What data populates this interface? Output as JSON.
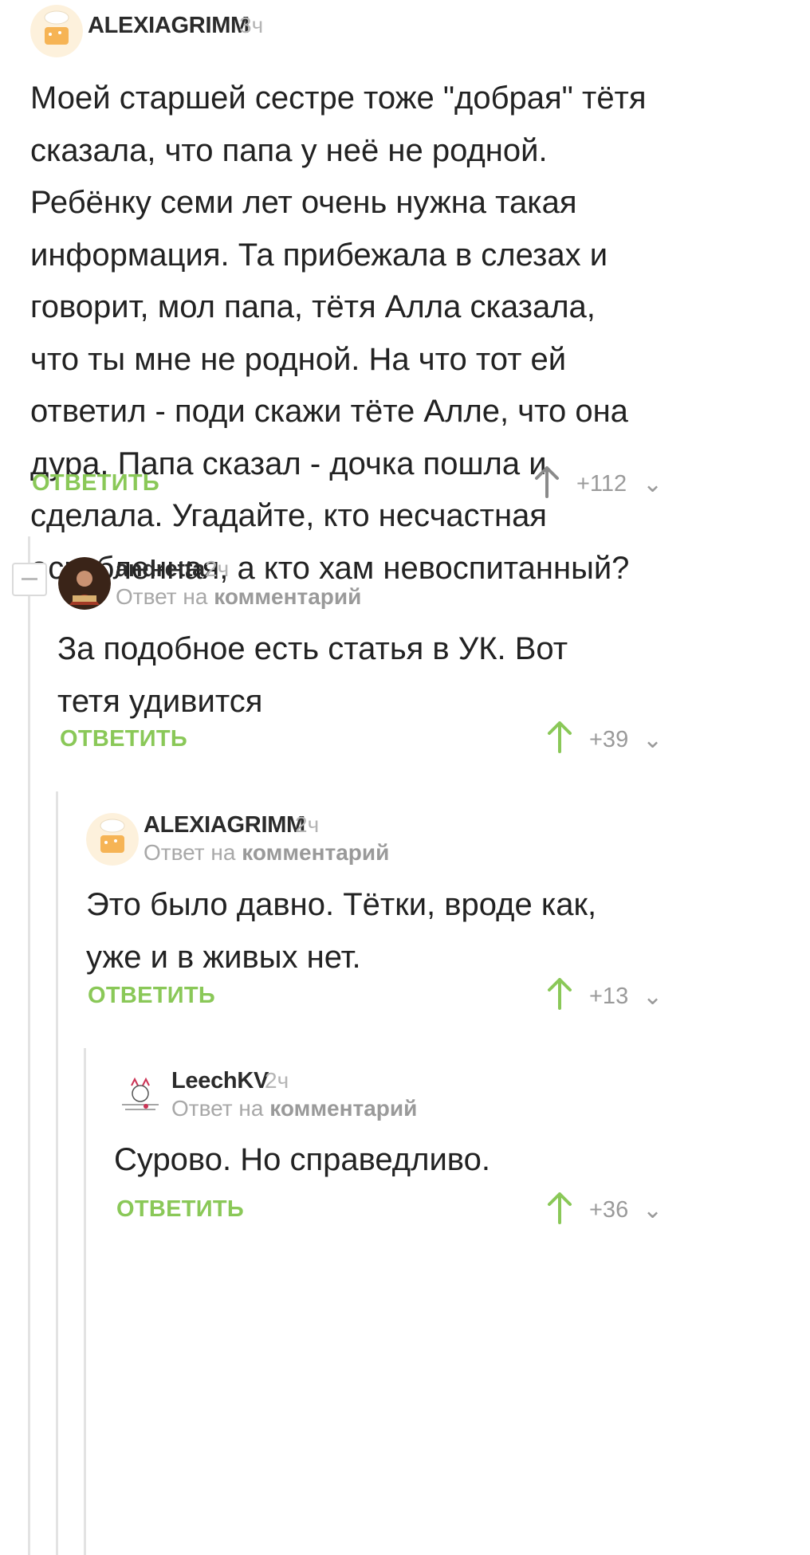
{
  "comments": [
    {
      "username": "ALEXIAGRIMM",
      "time": "3ч",
      "text": "Моей старшей сестре тоже \"добрая\" тётя сказала, что папа у неё не родной. Ребёнку семи лет очень нужна такая информация. Та прибежала в слезах и говорит, мол папа, тётя Алла сказала, что ты мне не родной. На что тот ей ответил - поди скажи тёте Алле, что она дура. Папа сказал - дочка пошла и сделала. Угадайте, кто несчастная оскобленная, а кто хам невоспитанный?",
      "reply_label": "ОТВЕТИТЬ",
      "rating": "+112",
      "arrow_color": "#8a8a8a"
    },
    {
      "username": "andretta",
      "time": "2ч",
      "reply_to_prefix": "Ответ на",
      "reply_to_link": "комментарий",
      "text": "За подобное есть статья в УК. Вот тетя удивится",
      "reply_label": "ОТВЕТИТЬ",
      "rating": "+39",
      "arrow_color": "#8ac858"
    },
    {
      "username": "ALEXIAGRIMM",
      "time": "2ч",
      "reply_to_prefix": "Ответ на",
      "reply_to_link": "комментарий",
      "text": "Это было давно. Тётки, вроде как, уже и в живых нет.",
      "reply_label": "ОТВЕТИТЬ",
      "rating": "+13",
      "arrow_color": "#8ac858"
    },
    {
      "username": "LeechKV",
      "time": "2ч",
      "reply_to_prefix": "Ответ на",
      "reply_to_link": "комментарий",
      "text": "Сурово. Но справедливо.",
      "reply_label": "ОТВЕТИТЬ",
      "rating": "+36",
      "arrow_color": "#8ac858"
    }
  ],
  "colors": {
    "accent_green": "#8ac858",
    "muted_gray": "#9a9a9a",
    "thread_line": "#e3e3e3"
  }
}
